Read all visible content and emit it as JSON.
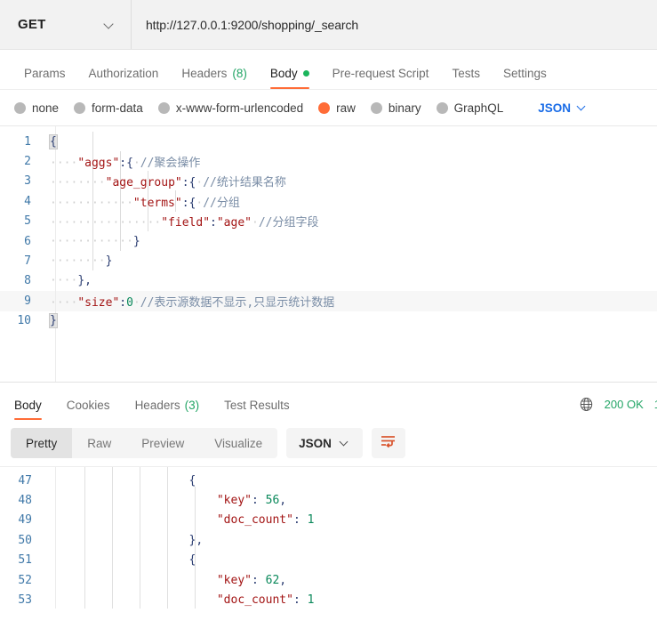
{
  "request": {
    "method": "GET",
    "method_icon": "chevron-down-icon",
    "url": "http://127.0.0.1:9200/shopping/_search"
  },
  "request_tabs": [
    {
      "label": "Params",
      "active": false,
      "count": "",
      "dot": false
    },
    {
      "label": "Authorization",
      "active": false,
      "count": "",
      "dot": false
    },
    {
      "label": "Headers",
      "active": false,
      "count": "(8)",
      "dot": false
    },
    {
      "label": "Body",
      "active": true,
      "count": "",
      "dot": true
    },
    {
      "label": "Pre-request Script",
      "active": false,
      "count": "",
      "dot": false
    },
    {
      "label": "Tests",
      "active": false,
      "count": "",
      "dot": false
    },
    {
      "label": "Settings",
      "active": false,
      "count": "",
      "dot": false
    }
  ],
  "body_types": [
    {
      "label": "none",
      "selected": false
    },
    {
      "label": "form-data",
      "selected": false
    },
    {
      "label": "x-www-form-urlencoded",
      "selected": false
    },
    {
      "label": "raw",
      "selected": true
    },
    {
      "label": "binary",
      "selected": false
    },
    {
      "label": "GraphQL",
      "selected": false
    }
  ],
  "body_format": {
    "label": "JSON",
    "icon": "chevron-down-icon"
  },
  "request_body": {
    "language": "json",
    "lines": [
      {
        "n": "1",
        "text": "{"
      },
      {
        "n": "2",
        "text": "    \"aggs\":{ //聚会操作"
      },
      {
        "n": "3",
        "text": "        \"age_group\":{ //统计结果名称"
      },
      {
        "n": "4",
        "text": "            \"terms\":{ //分组"
      },
      {
        "n": "5",
        "text": "                \"field\":\"age\" //分组字段"
      },
      {
        "n": "6",
        "text": "            }"
      },
      {
        "n": "7",
        "text": "        }"
      },
      {
        "n": "8",
        "text": "    },"
      },
      {
        "n": "9",
        "text": "    \"size\":0 //表示源数据不显示,只显示统计数据"
      },
      {
        "n": "10",
        "text": "}"
      }
    ],
    "raw_text": "{\n    \"aggs\":{ //聚会操作\n        \"age_group\":{ //统计结果名称\n            \"terms\":{ //分组\n                \"field\":\"age\" //分组字段\n            }\n        }\n    },\n    \"size\":0 //表示源数据不显示,只显示统计数据\n}"
  },
  "response_tabs": [
    {
      "label": "Body",
      "active": true,
      "count": ""
    },
    {
      "label": "Cookies",
      "active": false,
      "count": ""
    },
    {
      "label": "Headers",
      "active": false,
      "count": "(3)"
    },
    {
      "label": "Test Results",
      "active": false,
      "count": ""
    }
  ],
  "response_status": {
    "globe_icon": "globe-icon",
    "status": "200 OK",
    "truncated_next": "1"
  },
  "response_toolbar": {
    "views": [
      {
        "label": "Pretty",
        "active": true
      },
      {
        "label": "Raw",
        "active": false
      },
      {
        "label": "Preview",
        "active": false
      },
      {
        "label": "Visualize",
        "active": false
      }
    ],
    "format": {
      "label": "JSON",
      "icon": "chevron-down-icon"
    },
    "wrap_button_icon": "wrap-text-icon"
  },
  "response_body": {
    "lines": [
      {
        "n": "47",
        "text": "                    {"
      },
      {
        "n": "48",
        "text": "                        \"key\": 56,"
      },
      {
        "n": "49",
        "text": "                        \"doc_count\": 1"
      },
      {
        "n": "50",
        "text": "                    },"
      },
      {
        "n": "51",
        "text": "                    {"
      },
      {
        "n": "52",
        "text": "                        \"key\": 62,"
      },
      {
        "n": "53",
        "text": "                        \"doc_count\": 1"
      }
    ],
    "buckets": [
      {
        "key": "56",
        "doc_count": "1"
      },
      {
        "key": "62",
        "doc_count": "1"
      }
    ]
  },
  "colors": {
    "accent": "#ff6c37",
    "status_green": "#23a566",
    "link_blue": "#1a6ce7",
    "gutter_blue": "#3f78a8",
    "json_key": "#a31515",
    "json_number": "#09885a",
    "json_comment": "#7a8da6",
    "json_punct": "#2c3e72"
  }
}
